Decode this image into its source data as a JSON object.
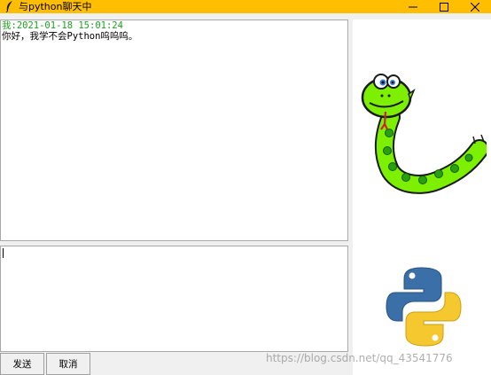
{
  "window": {
    "title": "与python聊天中",
    "icon": "feather-icon",
    "title_bar_color": "#ffbf00"
  },
  "chat": {
    "messages": [
      {
        "header": "我:2021-01-18 15:01:24",
        "body": "你好，我学不会Python呜呜呜。",
        "header_color": "#1f9f1f"
      }
    ]
  },
  "input": {
    "value": ""
  },
  "buttons": {
    "send_label": "发送",
    "cancel_label": "取消"
  },
  "side_panel": {
    "images": [
      "snake-cartoon",
      "python-logo"
    ]
  },
  "watermark": {
    "text": "https://blog.csdn.net/qq_43541776"
  }
}
